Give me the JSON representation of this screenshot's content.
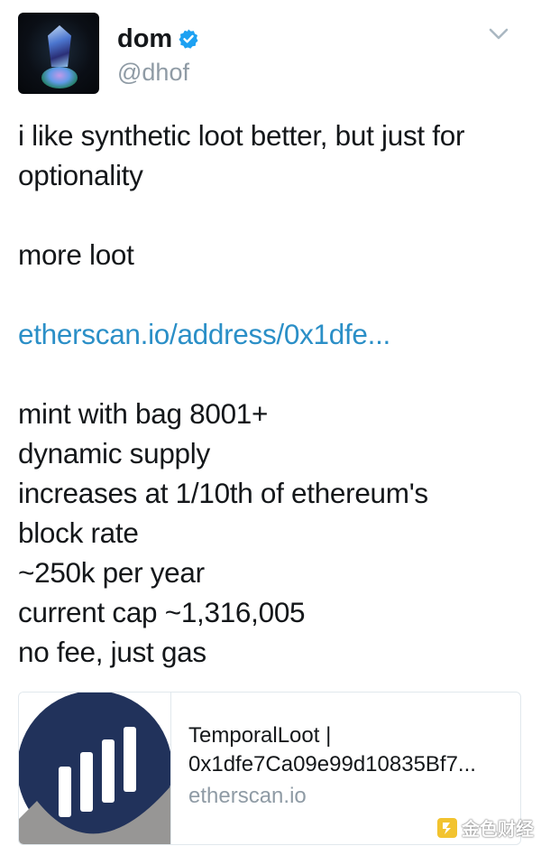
{
  "author": {
    "display_name": "dom",
    "handle": "@dhof",
    "verified": true,
    "avatar": "crystal-avatar"
  },
  "tweet": {
    "line1": "i like synthetic loot better, but just for",
    "line2": "optionality",
    "line3": "more loot",
    "link": "etherscan.io/address/0x1dfe...",
    "line4": "mint with bag 8001+",
    "line5": "dynamic supply",
    "line6": "increases at 1/10th of ethereum's",
    "line7": "block rate",
    "line8": "~250k per year",
    "line9": "current cap ~1,316,005",
    "line10": "no fee, just gas"
  },
  "card": {
    "title": "TemporalLoot |",
    "subtitle": "0x1dfe7Ca09e99d10835Bf7...",
    "domain": "etherscan.io",
    "thumb_icon": "etherscan-logo-icon"
  },
  "watermark": {
    "text": "金色财经",
    "icon": "jinse-logo-icon"
  },
  "colors": {
    "link": "#2b8fc7",
    "verified": "#1da1f2",
    "secondary_text": "#8f9ba5",
    "etherscan_blue": "#21325b",
    "etherscan_gray": "#979695"
  }
}
